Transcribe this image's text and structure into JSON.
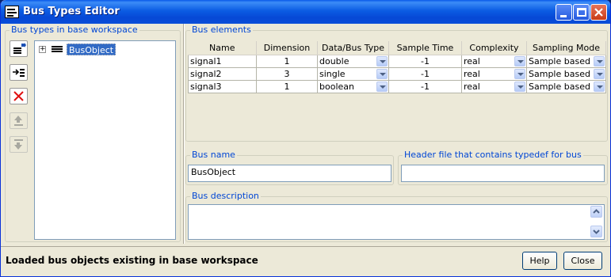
{
  "window": {
    "title": "Bus Types Editor"
  },
  "left_panel": {
    "legend": "Bus types in base workspace",
    "tree": [
      {
        "label": "BusObject",
        "selected": true
      }
    ]
  },
  "bus_elements": {
    "legend": "Bus elements",
    "columns": [
      "Name",
      "Dimension",
      "Data/Bus Type",
      "Sample Time",
      "Complexity",
      "Sampling Mode"
    ],
    "rows": [
      {
        "name": "signal1",
        "dimension": "1",
        "type": "double",
        "sample_time": "-1",
        "complexity": "real",
        "mode": "Sample based"
      },
      {
        "name": "signal2",
        "dimension": "3",
        "type": "single",
        "sample_time": "-1",
        "complexity": "real",
        "mode": "Sample based"
      },
      {
        "name": "signal3",
        "dimension": "1",
        "type": "boolean",
        "sample_time": "-1",
        "complexity": "real",
        "mode": "Sample based"
      }
    ]
  },
  "bus_name": {
    "legend": "Bus name",
    "value": "BusObject"
  },
  "header_file": {
    "legend": "Header file that contains typedef for bus",
    "value": ""
  },
  "bus_description": {
    "legend": "Bus description",
    "value": ""
  },
  "status": {
    "text": "Loaded bus objects existing in base workspace"
  },
  "buttons": {
    "help": "Help",
    "close": "Close"
  },
  "colors": {
    "title_bar": "#0a5ae8",
    "legend_text": "#0046d5",
    "selection": "#316ac5",
    "window_bg": "#ece9d8"
  }
}
